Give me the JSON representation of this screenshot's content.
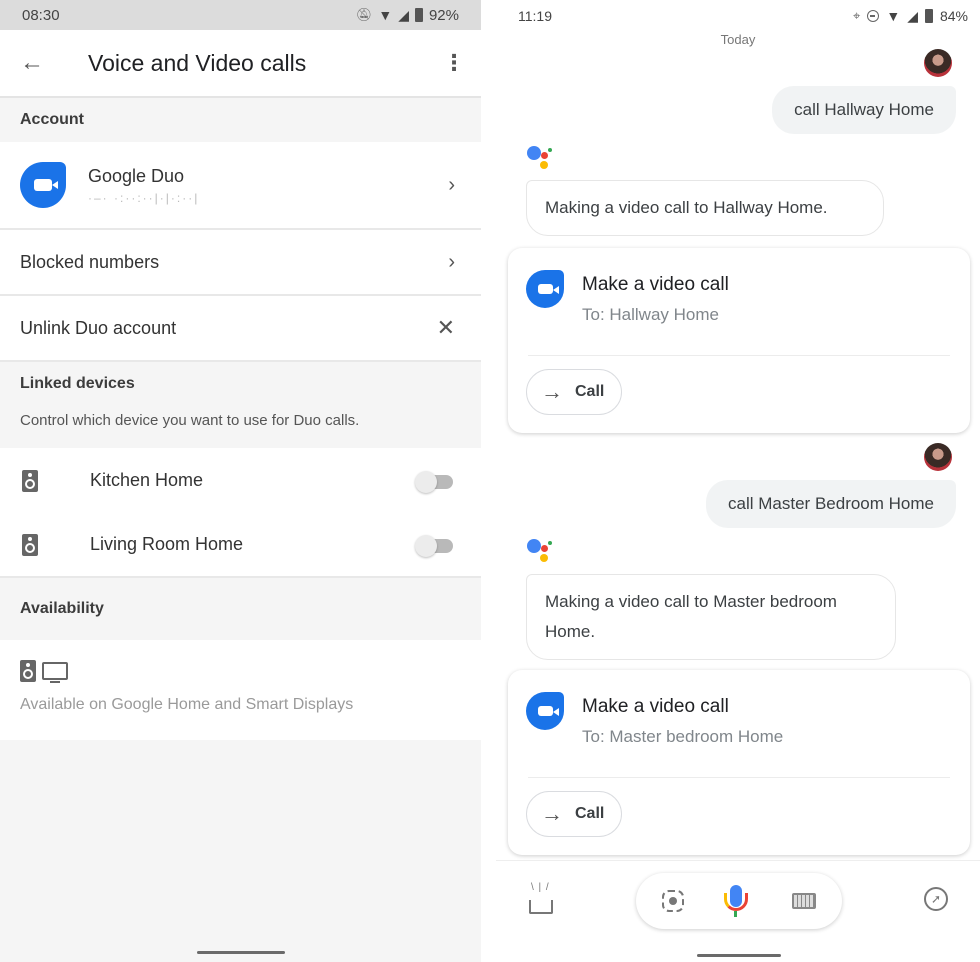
{
  "left": {
    "status": {
      "time": "08:30",
      "battery": "92%",
      "icons": [
        "notifications-off-icon",
        "wifi-icon",
        "signal-icon",
        "battery-icon"
      ]
    },
    "appbar": {
      "back_icon": "arrow-back-icon",
      "title": "Voice and Video calls",
      "menu_icon": "more-vert-icon"
    },
    "sections": {
      "account": "Account",
      "linked_devices": "Linked devices",
      "linked_devices_desc": "Control which device you want to use for Duo calls.",
      "availability": "Availability"
    },
    "account_rows": {
      "duo": {
        "name": "Google Duo",
        "sub": "·–· ·:··:··|·|·:··|",
        "chevron": "›"
      },
      "blocked": {
        "label": "Blocked numbers",
        "chevron": "›"
      },
      "unlink": {
        "label": "Unlink Duo account",
        "close": "✕"
      }
    },
    "devices": [
      {
        "label": "Kitchen Home",
        "enabled": false
      },
      {
        "label": "Living Room Home",
        "enabled": false
      }
    ],
    "availability_text": "Available on Google Home and Smart Displays"
  },
  "right": {
    "status": {
      "time": "11:19",
      "battery": "84%",
      "icons": [
        "location-icon",
        "do-not-disturb-icon",
        "wifi-icon",
        "signal-icon",
        "battery-icon"
      ]
    },
    "date_label": "Today",
    "conversation": [
      {
        "user": "call Hallway Home",
        "assistant": "Making a video call to Hallway Home.",
        "card": {
          "title": "Make a video call",
          "sub": "To: Hallway Home",
          "button": "Call",
          "button_icon": "→"
        }
      },
      {
        "user": "call Master Bedroom Home",
        "assistant": "Making a video call to Master bedroom Home.",
        "card": {
          "title": "Make a video call",
          "sub": "To: Master bedroom Home",
          "button": "Call",
          "button_icon": "→"
        }
      }
    ],
    "bottom_bar": {
      "left_icon": "updates-tray-icon",
      "pill_icons": [
        "lens-icon",
        "mic-icon",
        "keyboard-icon"
      ],
      "right_icon": "explore-compass-icon"
    }
  },
  "colors": {
    "duo_blue": "#1a73e8",
    "ga_blue": "#4285f4",
    "ga_red": "#ea4335",
    "ga_yellow": "#fbbc04",
    "ga_green": "#34a853"
  }
}
